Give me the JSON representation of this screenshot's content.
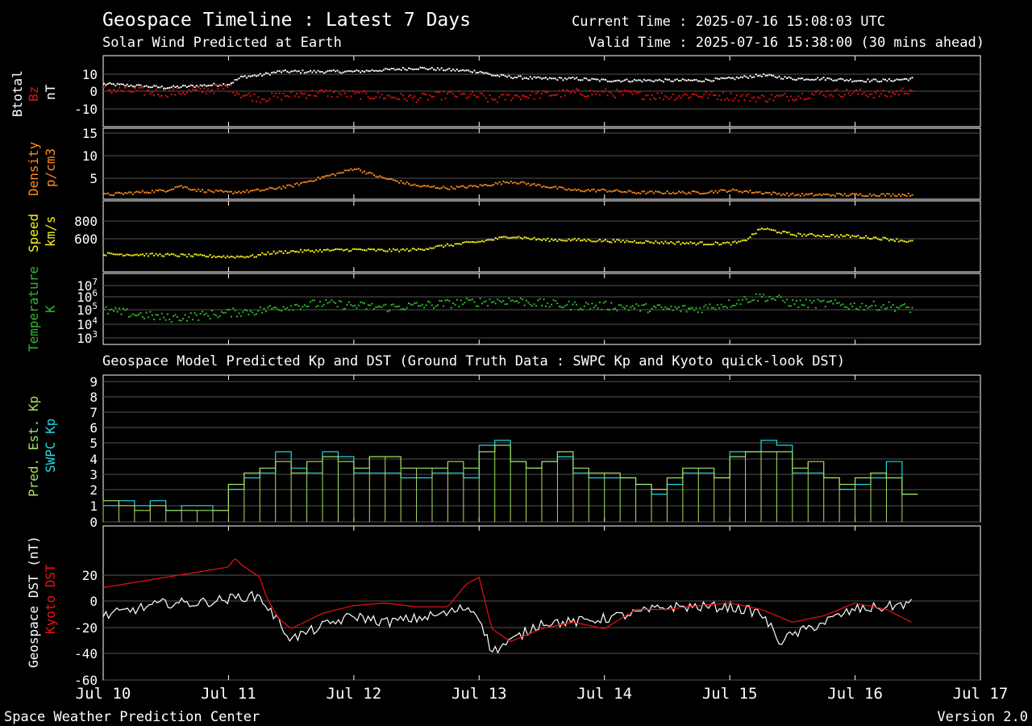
{
  "header": {
    "title": "Geospace Timeline : Latest 7 Days",
    "subtitle": "Solar Wind Predicted at Earth",
    "current_time": "Current Time : 2025-07-16 15:08:03 UTC",
    "valid_time": "Valid Time : 2025-07-16 15:38:00 (30 mins ahead)",
    "section2_title": "Geospace Model Predicted Kp and DST (Ground Truth Data : SWPC Kp and Kyoto quick-look DST)"
  },
  "footer": {
    "left": "Space Weather Prediction Center",
    "right": "Version 2.0"
  },
  "colors": {
    "background": "#000000",
    "btotal": "#ffffff",
    "bz": "#e01010",
    "density": "#ff8c1a",
    "speed": "#f5f51e",
    "temperature": "#2eb82e",
    "pred_kp": "#a8e060",
    "swpc_kp": "#22d8e0",
    "geospace_dst": "#ffffff",
    "kyoto_dst": "#ee1111",
    "grid": "#555555"
  },
  "panel_labels": {
    "mag": [
      "Btotal",
      "Bz",
      "nT"
    ],
    "density": [
      "Density",
      "p/cm3"
    ],
    "speed": [
      "Speed",
      "km/s"
    ],
    "temperature": [
      "Temperature",
      "K"
    ],
    "kp": [
      "Pred. Est. Kp",
      "SWPC Kp"
    ],
    "dst": [
      "Geospace DST (nT)",
      "Kyoto DST"
    ]
  },
  "x_ticks": [
    "Jul 10",
    "Jul 11",
    "Jul 12",
    "Jul 13",
    "Jul 14",
    "Jul 15",
    "Jul 16",
    "Jul 17"
  ],
  "chart_data": [
    {
      "type": "scatter",
      "name": "mag",
      "y_ticks": [
        "10",
        "0",
        "-10"
      ],
      "ylim": [
        -20,
        20
      ],
      "series": [
        {
          "name": "Btotal",
          "color_key": "btotal",
          "x": [
            0,
            0.25,
            0.5,
            0.75,
            1,
            1.1,
            1.25,
            1.4,
            1.5,
            1.75,
            2,
            2.25,
            2.5,
            2.75,
            3,
            3.1,
            3.25,
            3.5,
            3.75,
            4,
            4.25,
            4.5,
            4.75,
            5,
            5.25,
            5.5,
            5.75,
            6,
            6.25,
            6.45
          ],
          "y": [
            4,
            3,
            2,
            3,
            4,
            8,
            9,
            11,
            11,
            11,
            11,
            12,
            13,
            12,
            11,
            9,
            8,
            7,
            7,
            6,
            6,
            6,
            6,
            7,
            9,
            7,
            7,
            6,
            6,
            7
          ]
        },
        {
          "name": "Bz",
          "color_key": "bz",
          "x": [
            0,
            0.25,
            0.5,
            0.75,
            1,
            1.1,
            1.25,
            1.4,
            1.5,
            1.75,
            2,
            2.25,
            2.5,
            2.75,
            3,
            3.1,
            3.25,
            3.5,
            3.75,
            4,
            4.25,
            4.5,
            4.75,
            5,
            5.25,
            5.5,
            5.75,
            6,
            6.25,
            6.45
          ],
          "y": [
            1,
            0,
            -1,
            0,
            2,
            -2,
            -4,
            -3,
            -2,
            -1,
            -2,
            -3,
            -4,
            -2,
            -3,
            -5,
            -3,
            -2,
            -1,
            -1,
            -2,
            -3,
            -2,
            -3,
            -4,
            -3,
            -1,
            -1,
            -2,
            1
          ]
        }
      ]
    },
    {
      "type": "scatter",
      "name": "density",
      "y_ticks": [
        "15",
        "10",
        "5"
      ],
      "ylim": [
        0,
        16
      ],
      "series": [
        {
          "name": "Density",
          "color_key": "density",
          "x": [
            0,
            0.25,
            0.5,
            0.6,
            0.75,
            1,
            1.25,
            1.5,
            1.75,
            1.9,
            2,
            2.2,
            2.5,
            2.75,
            3,
            3.25,
            3.5,
            3.75,
            4,
            4.25,
            4.5,
            4.75,
            5,
            5.25,
            5.5,
            5.75,
            6,
            6.25,
            6.45
          ],
          "y": [
            1,
            1.5,
            2,
            3,
            2,
            1.5,
            2,
            3,
            5,
            6,
            7,
            5,
            3,
            2.5,
            3,
            4,
            3,
            2,
            2,
            1.5,
            1.5,
            1.5,
            2,
            1.5,
            1,
            1,
            1,
            1,
            1
          ]
        }
      ]
    },
    {
      "type": "scatter",
      "name": "speed",
      "y_ticks": [
        "800",
        "600"
      ],
      "ylim": [
        200,
        1000
      ],
      "series": [
        {
          "name": "Speed",
          "color_key": "speed",
          "x": [
            0,
            0.25,
            0.5,
            0.75,
            1,
            1.2,
            1.3,
            1.5,
            1.75,
            2,
            2.25,
            2.5,
            2.75,
            3,
            3.25,
            3.5,
            3.75,
            4,
            4.25,
            4.5,
            4.75,
            5,
            5.1,
            5.25,
            5.5,
            5.75,
            6,
            6.25,
            6.45
          ],
          "y": [
            400,
            395,
            390,
            380,
            370,
            375,
            410,
            430,
            440,
            450,
            440,
            450,
            500,
            540,
            600,
            560,
            560,
            550,
            540,
            530,
            520,
            520,
            540,
            690,
            620,
            610,
            600,
            570,
            540
          ]
        }
      ]
    },
    {
      "type": "scatter",
      "name": "temperature",
      "y_ticks": [
        "10^7",
        "10^6",
        "10^5",
        "10^4",
        "10^3"
      ],
      "y_scale": "log",
      "ylim": [
        1000,
        10000000
      ],
      "series": [
        {
          "name": "Temperature",
          "color_key": "temperature",
          "x": [
            0,
            0.25,
            0.5,
            0.75,
            1,
            1.25,
            1.5,
            1.75,
            2,
            2.25,
            2.5,
            2.75,
            3,
            3.25,
            3.5,
            3.75,
            4,
            4.25,
            4.5,
            4.75,
            5,
            5.25,
            5.5,
            5.75,
            6,
            6.25,
            6.45
          ],
          "y": [
            80000,
            50000,
            30000,
            40000,
            60000,
            80000,
            150000,
            200000,
            150000,
            120000,
            150000,
            200000,
            250000,
            300000,
            200000,
            150000,
            150000,
            120000,
            100000,
            100000,
            200000,
            500000,
            200000,
            200000,
            150000,
            150000,
            100000
          ]
        }
      ]
    },
    {
      "type": "line",
      "name": "kp",
      "y_ticks": [
        "9",
        "8",
        "7",
        "6",
        "5",
        "4",
        "3",
        "2",
        "1",
        "0"
      ],
      "ylim": [
        0,
        9
      ],
      "series": [
        {
          "name": "SWPC Kp",
          "color_key": "swpc_kp",
          "x": [
            0,
            0.125,
            0.25,
            0.375,
            0.5,
            0.625,
            0.75,
            0.875,
            1,
            1.125,
            1.25,
            1.375,
            1.5,
            1.625,
            1.75,
            1.875,
            2,
            2.125,
            2.25,
            2.375,
            2.5,
            2.625,
            2.75,
            2.875,
            3,
            3.125,
            3.25,
            3.375,
            3.5,
            3.625,
            3.75,
            3.875,
            4,
            4.125,
            4.25,
            4.375,
            4.5,
            4.625,
            4.75,
            4.875,
            5,
            5.125,
            5.25,
            5.375,
            5.5,
            5.625,
            5.75,
            5.875,
            6,
            6.125,
            6.25,
            6.375
          ],
          "y": [
            1,
            1.3,
            1,
            1.3,
            0.7,
            1,
            1,
            0.7,
            2,
            2.7,
            3,
            4.3,
            3.3,
            3,
            4.3,
            4,
            3,
            3,
            3,
            2.7,
            2.7,
            3,
            3,
            2.7,
            4.7,
            5,
            3.7,
            3.3,
            3.7,
            4,
            3,
            2.7,
            2.7,
            2.7,
            2.3,
            1.7,
            2.3,
            3,
            3,
            2.7,
            4.3,
            4.3,
            5,
            4.7,
            3,
            3,
            2.7,
            2,
            2.3,
            2.7,
            3.7,
            1.7
          ]
        },
        {
          "name": "Pred. Est. Kp",
          "color_key": "pred_kp",
          "x": [
            0,
            0.125,
            0.25,
            0.375,
            0.5,
            0.625,
            0.75,
            0.875,
            1,
            1.125,
            1.25,
            1.375,
            1.5,
            1.625,
            1.75,
            1.875,
            2,
            2.125,
            2.25,
            2.375,
            2.5,
            2.625,
            2.75,
            2.875,
            3,
            3.125,
            3.25,
            3.375,
            3.5,
            3.625,
            3.75,
            3.875,
            4,
            4.125,
            4.25,
            4.375,
            4.5,
            4.625,
            4.75,
            4.875,
            5,
            5.125,
            5.25,
            5.375,
            5.5,
            5.625,
            5.75,
            5.875,
            6,
            6.125,
            6.25,
            6.375
          ],
          "y": [
            1.3,
            1,
            0.7,
            1,
            0.7,
            0.7,
            0.7,
            0.7,
            2.3,
            3,
            3.3,
            3.7,
            3,
            3.7,
            4,
            3.7,
            3.3,
            4,
            4,
            3.3,
            3.3,
            3.3,
            3.7,
            3.3,
            4.3,
            4.7,
            3.7,
            3.3,
            3.7,
            4.3,
            3.3,
            3,
            3,
            2.7,
            2.3,
            2,
            2.7,
            3.3,
            3.3,
            2.7,
            4,
            4.3,
            4.3,
            4.3,
            3.3,
            3.7,
            2.7,
            2.3,
            2.7,
            3,
            2.7,
            1.7
          ]
        }
      ]
    },
    {
      "type": "line",
      "name": "dst",
      "y_ticks": [
        "20",
        "0",
        "-20",
        "-40",
        "-60"
      ],
      "ylim": [
        -60,
        60
      ],
      "series": [
        {
          "name": "Geospace DST (nT)",
          "color_key": "geospace_dst",
          "x": [
            0,
            0.25,
            0.5,
            0.75,
            1,
            1.1,
            1.25,
            1.4,
            1.5,
            1.75,
            2,
            2.25,
            2.5,
            2.75,
            2.9,
            3,
            3.1,
            3.25,
            3.5,
            3.75,
            4,
            4.25,
            4.5,
            4.75,
            5,
            5.25,
            5.4,
            5.5,
            5.75,
            6,
            6.25,
            6.45
          ],
          "y": [
            -10,
            -5,
            0,
            0,
            3,
            5,
            5,
            -15,
            -28,
            -18,
            -10,
            -15,
            -12,
            -8,
            -3,
            -10,
            -38,
            -30,
            -15,
            -15,
            -12,
            -8,
            -3,
            -3,
            -3,
            -8,
            -30,
            -25,
            -15,
            -5,
            -3,
            0
          ]
        },
        {
          "name": "Kyoto DST",
          "color_key": "kyoto_dst",
          "x": [
            0,
            0.25,
            0.5,
            0.75,
            1,
            1.05,
            1.1,
            1.25,
            1.3,
            1.4,
            1.5,
            1.75,
            2,
            2.25,
            2.5,
            2.75,
            2.9,
            3,
            3.1,
            3.25,
            3.5,
            3.75,
            4,
            4.25,
            4.5,
            4.75,
            5,
            5.25,
            5.5,
            5.75,
            6,
            6.25,
            6.45
          ],
          "y": [
            12,
            16,
            20,
            24,
            28,
            35,
            30,
            20,
            5,
            -12,
            -20,
            -8,
            -2,
            0,
            -3,
            -3,
            15,
            20,
            -20,
            -30,
            -20,
            -15,
            -20,
            -5,
            -5,
            -2,
            0,
            -5,
            -15,
            -10,
            0,
            -5,
            -15
          ]
        }
      ]
    }
  ]
}
